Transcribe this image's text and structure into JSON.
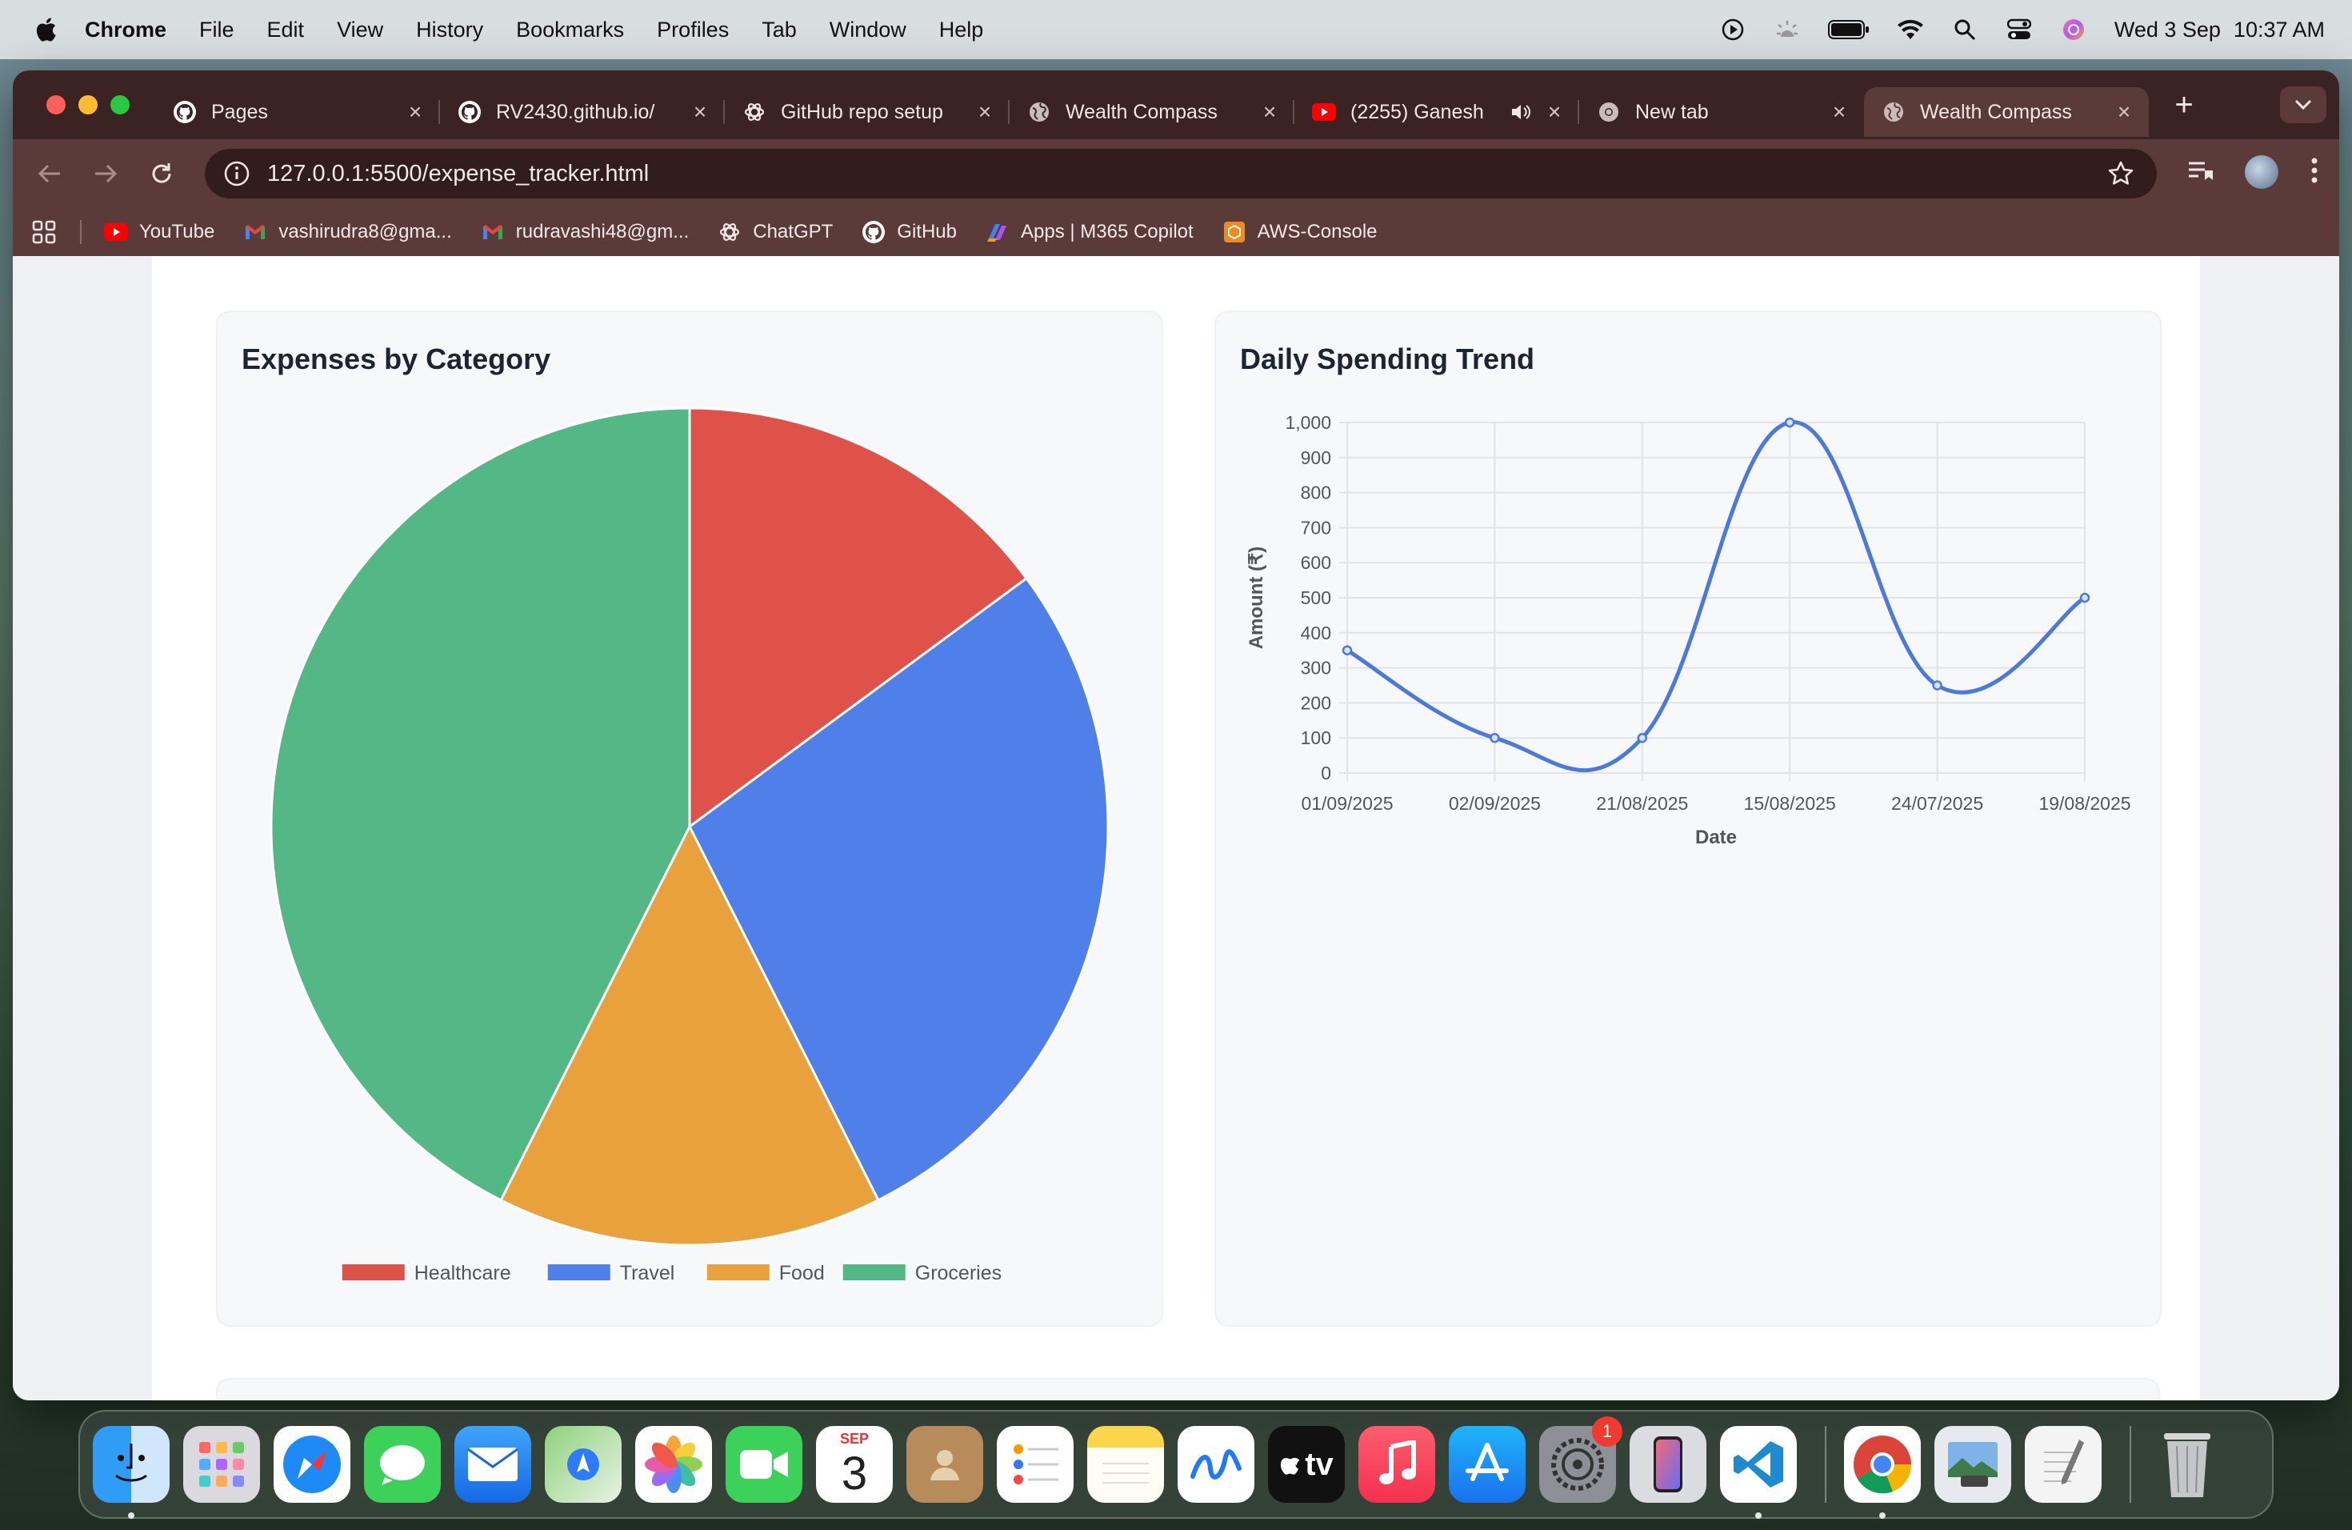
{
  "menubar": {
    "app_name": "Chrome",
    "items": [
      "File",
      "Edit",
      "View",
      "History",
      "Bookmarks",
      "Profiles",
      "Tab",
      "Window",
      "Help"
    ],
    "date": "Wed 3 Sep",
    "time": "10:37 AM"
  },
  "tabs": [
    {
      "label": "Pages",
      "icon": "github-icon"
    },
    {
      "label": "RV2430.github.io/",
      "icon": "github-icon"
    },
    {
      "label": "GitHub repo setup",
      "icon": "chatgpt-icon"
    },
    {
      "label": "Wealth Compass",
      "icon": "globe-icon"
    },
    {
      "label": "(2255) Ganesh",
      "icon": "youtube-icon"
    },
    {
      "label": "New tab",
      "icon": "chrome-icon"
    },
    {
      "label": "Wealth Compass",
      "icon": "globe-icon",
      "active": true
    }
  ],
  "address_bar": {
    "url": "127.0.0.1:5500/expense_tracker.html"
  },
  "bookmarks": [
    {
      "label": "YouTube",
      "icon": "youtube-icon"
    },
    {
      "label": "vashirudra8@gma...",
      "icon": "gmail-icon"
    },
    {
      "label": "rudravashi48@gm...",
      "icon": "gmail-icon"
    },
    {
      "label": "ChatGPT",
      "icon": "chatgpt-icon"
    },
    {
      "label": "GitHub",
      "icon": "github-icon"
    },
    {
      "label": "Apps | M365 Copilot",
      "icon": "copilot-icon"
    },
    {
      "label": "AWS-Console",
      "icon": "aws-icon"
    }
  ],
  "pie_card": {
    "title": "Expenses by Category"
  },
  "line_card": {
    "title": "Daily Spending Trend"
  },
  "chart_data": [
    {
      "type": "pie",
      "title": "Expenses by Category",
      "categories": [
        "Healthcare",
        "Travel",
        "Food",
        "Groceries"
      ],
      "values": [
        350,
        650,
        350,
        1000
      ],
      "colors": [
        "#df524a",
        "#4f80ea",
        "#e9a23b",
        "#54b786"
      ],
      "legend": "bottom"
    },
    {
      "type": "line",
      "title": "Daily Spending Trend",
      "x": [
        "01/09/2025",
        "02/09/2025",
        "21/08/2025",
        "15/08/2025",
        "24/07/2025",
        "19/08/2025"
      ],
      "values": [
        350,
        100,
        100,
        1000,
        250,
        500
      ],
      "xlabel": "Date",
      "ylabel": "Amount (₹)",
      "ylim": [
        0,
        1000
      ],
      "yticks": [
        "0",
        "100",
        "200",
        "300",
        "400",
        "500",
        "600",
        "700",
        "800",
        "900",
        "1,000"
      ],
      "color": "#4a7ae0",
      "grid": true
    }
  ],
  "dock": {
    "apps": [
      "finder-icon",
      "launchpad-icon",
      "safari-icon",
      "messages-icon",
      "mail-icon",
      "maps-icon",
      "photos-icon",
      "facetime-icon",
      "calendar-icon",
      "contacts-icon",
      "reminders-icon",
      "notes-icon",
      "freeform-icon",
      "tv-icon",
      "music-icon",
      "app-store-icon",
      "system-settings-icon",
      "iphone-mirroring-icon",
      "vscode-icon",
      "chrome-icon",
      "preview-icon",
      "textedit-icon",
      "trash-icon"
    ],
    "calendar_month": "SEP",
    "calendar_day": "3",
    "settings_badge": "1",
    "tv_label": "tv"
  }
}
